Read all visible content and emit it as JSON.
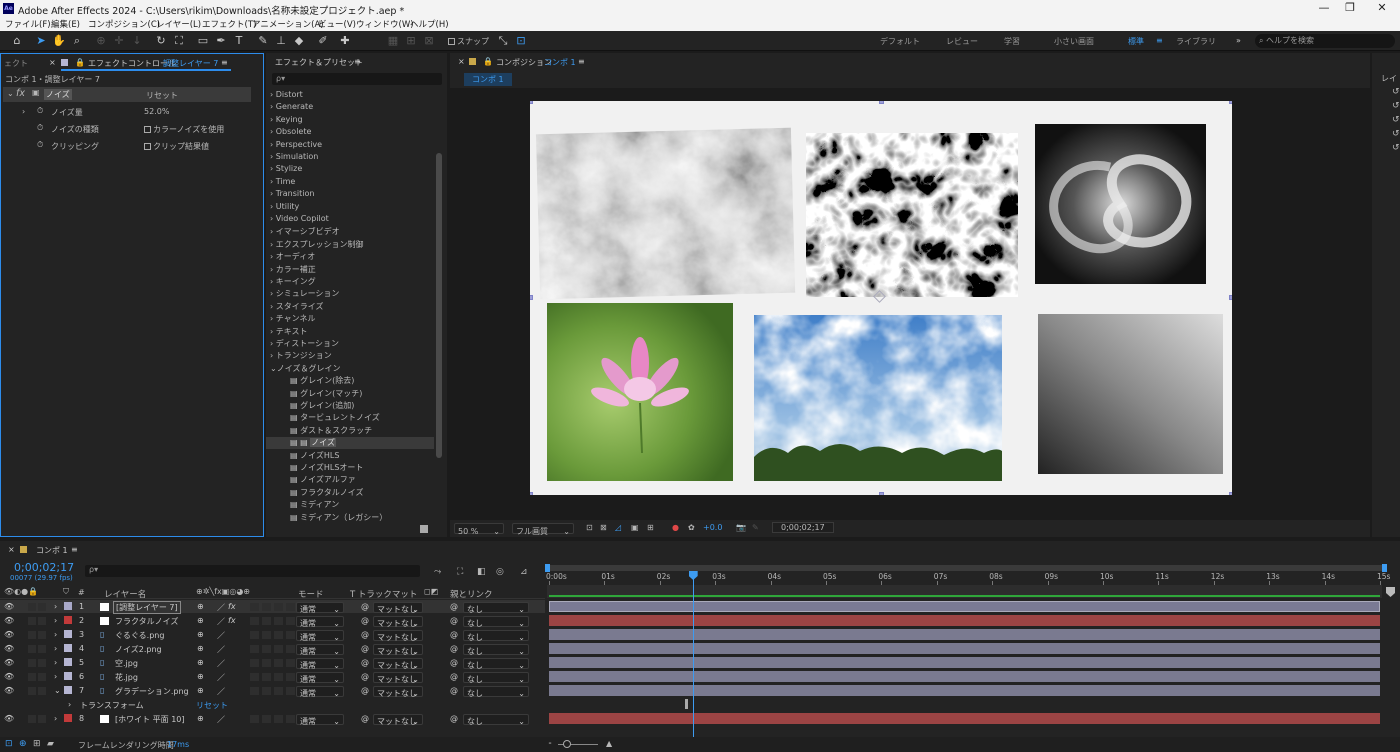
{
  "app": {
    "icon_text": "Ae",
    "title": "Adobe After Effects 2024 - C:\\Users\\rikim\\Downloads\\名称未設定プロジェクト.aep *"
  },
  "menu": [
    "ファイル(F)",
    "編集(E)",
    "コンポジション(C)",
    "レイヤー(L)",
    "エフェクト(T)",
    "アニメーション(A)",
    "ビュー(V)",
    "ウィンドウ(W)",
    "ヘルプ(H)"
  ],
  "toolbar": {
    "snap_label": "スナップ",
    "workspaces": [
      "デフォルト",
      "レビュー",
      "学習",
      "小さい画面",
      "標準",
      "ライブラリ"
    ],
    "active_workspace": "標準",
    "help_placeholder": "ヘルプを検索"
  },
  "effect_controls": {
    "tab_cut": "ェクト",
    "tab_label": "エフェクトコントロール",
    "tab_layer": "調整レイヤー 7",
    "breadcrumb": "コンポ 1・調整レイヤー 7",
    "fx_label": "fx",
    "effect_name": "ノイズ",
    "reset": "リセット",
    "props": [
      {
        "name": "ノイズ量",
        "value": "52.0%"
      },
      {
        "name": "ノイズの種類",
        "value": "カラーノイズを使用"
      },
      {
        "name": "クリッピング",
        "value": "クリップ結果値"
      }
    ]
  },
  "effects_presets": {
    "title": "エフェクト＆プリセット",
    "search_glyph": "ρ▾",
    "categories": [
      "Distort",
      "Generate",
      "Keying",
      "Obsolete",
      "Perspective",
      "Simulation",
      "Stylize",
      "Time",
      "Transition",
      "Utility",
      "Video Copilot",
      "イマーシブビデオ",
      "エクスプレッション制御",
      "オーディオ",
      "カラー補正",
      "キーイング",
      "シミュレーション",
      "スタイライズ",
      "チャンネル",
      "テキスト",
      "ディストーション",
      "トランジション"
    ],
    "open_category": "ノイズ＆グレイン",
    "items": [
      "グレイン(除去)",
      "グレイン(マッチ)",
      "グレイン(追加)",
      "タービュレントノイズ",
      "ダスト＆スクラッチ",
      "ノイズ",
      "ノイズHLS",
      "ノイズHLSオート",
      "ノイズアルファ",
      "フラクタルノイズ",
      "ミディアン",
      "ミディアン（レガシー）"
    ],
    "selected_item": "ノイズ"
  },
  "composition": {
    "tab_prefix": "コンポジション",
    "tab_name": "コンポ 1",
    "flow_tab": "コンポ 1"
  },
  "viewer": {
    "zoom": "50 %",
    "resolution": "フル画質",
    "exposure": "+0.0",
    "timecode": "0;00;02;17"
  },
  "timeline": {
    "tab": "コンポ 1",
    "timecode": "0;00;02;17",
    "fps": "00077 (29.97 fps)",
    "headers": {
      "num": "#",
      "name": "レイヤー名",
      "mode": "モード",
      "trackmatte": "T トラックマット",
      "parent": "親とリンク"
    },
    "layers": [
      {
        "num": "1",
        "name": "[調整レイヤー 7]",
        "label": "#a9a9c9",
        "mode": "通常",
        "matte": "マットなし",
        "parent": "なし",
        "bar": "#7a7a94"
      },
      {
        "num": "2",
        "name": "フラクタルノイズ",
        "label": "#c23a3a",
        "mode": "通常",
        "matte": "マットなし",
        "parent": "なし",
        "bar": "#9c4444"
      },
      {
        "num": "3",
        "name": "ぐるぐる.png",
        "label": "#b5b5d2",
        "mode": "通常",
        "matte": "マットなし",
        "parent": "なし",
        "bar": "#7a7a90"
      },
      {
        "num": "4",
        "name": "ノイズ2.png",
        "label": "#b5b5d2",
        "mode": "通常",
        "matte": "マットなし",
        "parent": "なし",
        "bar": "#7a7a90"
      },
      {
        "num": "5",
        "name": "空.jpg",
        "label": "#b5b5d2",
        "mode": "通常",
        "matte": "マットなし",
        "parent": "なし",
        "bar": "#7a7a90"
      },
      {
        "num": "6",
        "name": "花.jpg",
        "label": "#b5b5d2",
        "mode": "通常",
        "matte": "マットなし",
        "parent": "なし",
        "bar": "#7a7a90"
      },
      {
        "num": "7",
        "name": "グラデーション.png",
        "label": "#b5b5d2",
        "mode": "通常",
        "matte": "マットなし",
        "parent": "なし",
        "bar": "#7a7a90"
      },
      {
        "num": "8",
        "name": "[ホワイト 平面 10]",
        "label": "#c23a3a",
        "mode": "通常",
        "matte": "マットなし",
        "parent": "なし",
        "bar": "#9c4444"
      }
    ],
    "transform_label": "トランスフォーム",
    "transform_reset": "リセット",
    "ruler": [
      "0:00s",
      "01s",
      "02s",
      "03s",
      "04s",
      "05s",
      "06s",
      "07s",
      "08s",
      "09s",
      "10s",
      "11s",
      "12s",
      "13s",
      "14s",
      "15s"
    ],
    "playhead_fraction": 0.1729,
    "render_label": "フレームレンダリング時間",
    "render_time": "17ms"
  },
  "colors": {
    "accent": "#3d9cf2",
    "panel": "#232323",
    "bg": "#1b1b1b"
  }
}
